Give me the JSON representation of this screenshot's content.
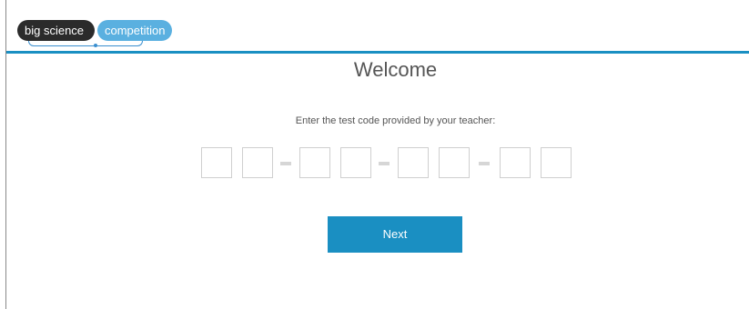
{
  "header": {
    "logo_part1": "big science",
    "logo_part2": "competition"
  },
  "main": {
    "title": "Welcome",
    "instruction": "Enter the test code provided by your teacher:",
    "code_fields": [
      "",
      "",
      "",
      "",
      "",
      "",
      "",
      ""
    ],
    "next_label": "Next"
  },
  "colors": {
    "accent": "#1a8fc2",
    "logo_dark": "#2b2b2b",
    "logo_light": "#5ab0e0"
  }
}
